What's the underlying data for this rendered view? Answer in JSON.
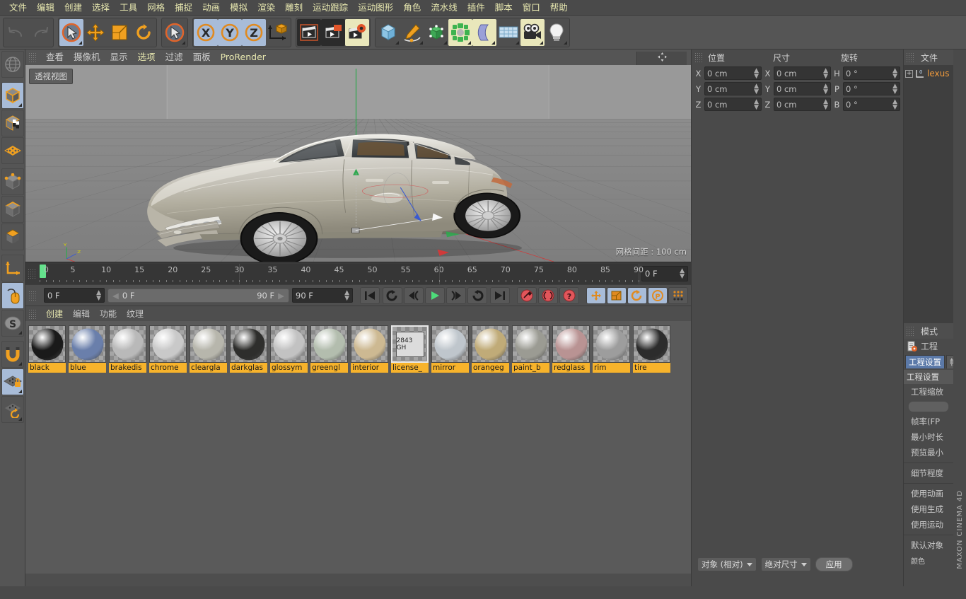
{
  "menubar": {
    "items": [
      "文件",
      "编辑",
      "创建",
      "选择",
      "工具",
      "网格",
      "捕捉",
      "动画",
      "模拟",
      "渲染",
      "雕刻",
      "运动跟踪",
      "运动图形",
      "角色",
      "流水线",
      "插件",
      "脚本",
      "窗口",
      "帮助"
    ]
  },
  "toolbar": {
    "undo": "undo-arrow",
    "redo": "redo-arrow",
    "groups": [
      "transform-tools",
      "axis-locks",
      "render-tools",
      "object-tools"
    ]
  },
  "left_toolbar": {
    "items": [
      "globe-icon",
      "cube-icon",
      "texture-cube-icon",
      "polygon-grid-icon",
      "point-mode-icon",
      "edge-mode-icon",
      "polygon-mode-icon",
      "axis-icon",
      "mouse-icon",
      "snap-s-icon",
      "magnet-icon",
      "lock-grid-icon",
      "workplane-icon"
    ]
  },
  "viewport": {
    "menu": [
      "查看",
      "摄像机",
      "显示",
      "选项",
      "过滤",
      "面板",
      "ProRender"
    ],
    "highlight": "选项",
    "prorender": "ProRender",
    "label": "透视视图",
    "grid_info": "网格间距 : 100 cm",
    "axis_labels": {
      "x": "X",
      "y": "Y",
      "z": "Z"
    }
  },
  "timeline": {
    "ticks": [
      0,
      5,
      10,
      15,
      20,
      25,
      30,
      35,
      40,
      45,
      50,
      55,
      60,
      65,
      70,
      75,
      80,
      85,
      90
    ],
    "current_frame_field": "0 F",
    "start_field": "0 F",
    "range_start_display": "0 F",
    "range_end_display": "90 F",
    "end_field": "90 F",
    "transport": [
      "go-to-start-icon",
      "loop-icon",
      "step-back-icon",
      "play-icon",
      "step-forward-icon",
      "play-reverse-icon",
      "go-to-end-icon"
    ],
    "key_buttons": [
      "record-key-icon",
      "autokey-icon",
      "key-help-icon"
    ],
    "key_toggles": [
      "position-key-icon",
      "scale-key-icon",
      "rotation-key-icon",
      "parametric-key-icon",
      "point-level-icon"
    ]
  },
  "material_manager": {
    "menu": [
      "创建",
      "编辑",
      "功能",
      "纹理"
    ],
    "highlight": "创建",
    "materials": [
      {
        "name": "black",
        "color": "#1a1a1a",
        "selected": false
      },
      {
        "name": "blue",
        "color": "#6a7fab",
        "selected": false
      },
      {
        "name": "brakedis",
        "color": "#b9b9b9",
        "selected": false
      },
      {
        "name": "chrome",
        "color": "#c9c9c9",
        "selected": false
      },
      {
        "name": "cleargla",
        "color": "#b7b6ac",
        "selected": false
      },
      {
        "name": "darkglas",
        "color": "#2e2e2c",
        "selected": false
      },
      {
        "name": "glossym",
        "color": "#c2c2c2",
        "selected": false
      },
      {
        "name": "greengl",
        "color": "#b3bdae",
        "selected": false
      },
      {
        "name": "interior",
        "color": "#cdb992",
        "selected": false
      },
      {
        "name": "license_",
        "color": "#e8e8e8",
        "selected": true
      },
      {
        "name": "mirror",
        "color": "#bfc6cc",
        "selected": false
      },
      {
        "name": "orangeg",
        "color": "#c0ab78",
        "selected": false
      },
      {
        "name": "paint_b",
        "color": "#9b9b93",
        "selected": false
      },
      {
        "name": "redglass",
        "color": "#b99393",
        "selected": false
      },
      {
        "name": "rim",
        "color": "#9d9d9d",
        "selected": false
      },
      {
        "name": "tire",
        "color": "#2c2c2c",
        "selected": false
      }
    ]
  },
  "object_manager": {
    "menu": [
      "文件"
    ],
    "objects": [
      {
        "name": "lexus",
        "expand": "+",
        "index": "0"
      }
    ]
  },
  "attributes": {
    "header": [
      "模式",
      "工程"
    ],
    "tabs": [
      {
        "label": "工程设置",
        "active": true
      },
      {
        "label": "帧插值",
        "active": false
      }
    ],
    "section": "工程设置",
    "rows": [
      "工程缩放",
      "帧率(FP",
      "最小时长",
      "预览最小",
      "细节程度",
      "使用动画",
      "使用生成",
      "使用运动",
      "默认对象",
      "颜色"
    ]
  },
  "coordinates": {
    "headers": [
      "位置",
      "尺寸",
      "旋转"
    ],
    "position": [
      {
        "label": "X",
        "value": "0 cm"
      },
      {
        "label": "Y",
        "value": "0 cm"
      },
      {
        "label": "Z",
        "value": "0 cm"
      }
    ],
    "size": [
      {
        "label": "X",
        "value": "0 cm"
      },
      {
        "label": "Y",
        "value": "0 cm"
      },
      {
        "label": "Z",
        "value": "0 cm"
      }
    ],
    "rotation": [
      {
        "label": "H",
        "value": "0 °"
      },
      {
        "label": "P",
        "value": "0 °"
      },
      {
        "label": "B",
        "value": "0 °"
      }
    ],
    "mode_dropdown": "对象 (相对)",
    "size_dropdown": "绝对尺寸",
    "apply_button": "应用"
  },
  "sidebar_brand": "MAXON CINEMA 4D",
  "statusbar": {
    "left": "",
    "right": ""
  },
  "colors": {
    "accent_orange": "#f7b32b",
    "selection_blue": "#a8bcd8",
    "menu_yellow": "#e8e8b0",
    "object_orange": "#f29b3c",
    "tab_blue": "#5b79a8"
  }
}
